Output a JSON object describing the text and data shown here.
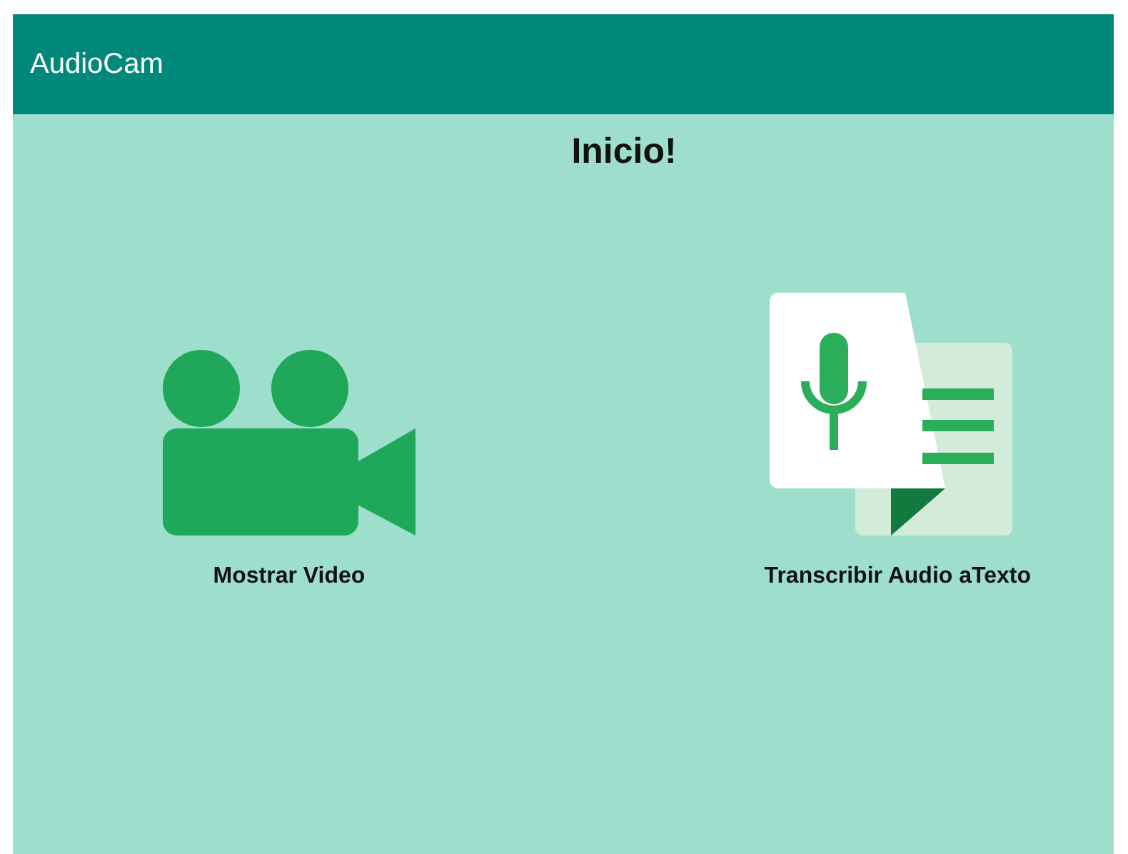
{
  "app_bar": {
    "title": "AudioCam"
  },
  "heading": "Inicio!",
  "actions": [
    {
      "kind": "video",
      "label": "Mostrar Video"
    },
    {
      "kind": "transcribe",
      "label": "Transcribir Audio aTexto"
    }
  ]
}
